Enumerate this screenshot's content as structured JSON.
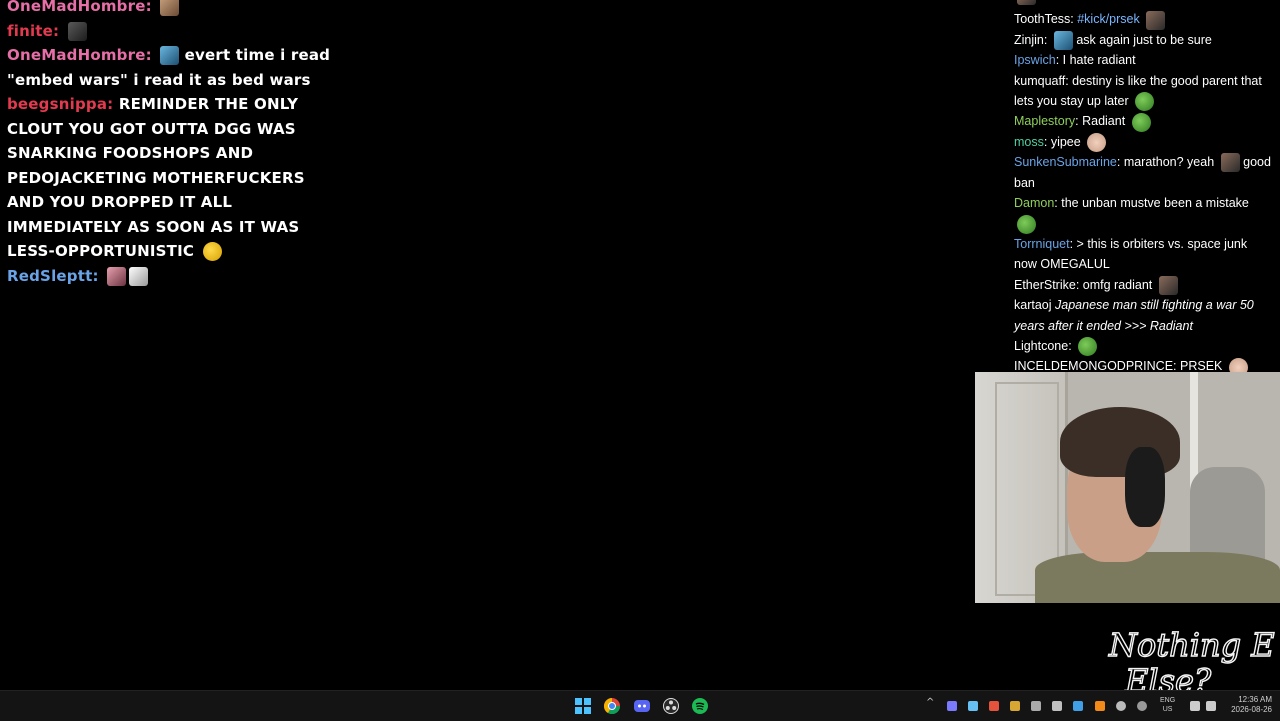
{
  "left_chat": [
    {
      "user": "OneMadHombre",
      "color": "pink",
      "text": "",
      "emotes": [
        "e-face"
      ]
    },
    {
      "user": "finite",
      "color": "red",
      "text": "",
      "emotes": [
        "e-dark"
      ]
    },
    {
      "user": "OneMadHombre",
      "color": "pink",
      "text": "evert time i read \"embed wars\" i read it as bed wars",
      "emotes_before": [
        "e-blue"
      ]
    },
    {
      "user": "beegsnippa",
      "color": "red",
      "text": "REMINDER THE ONLY CLOUT YOU GOT OUTTA DGG WAS SNARKING FOODSHOPS AND PEDOJACKETING MOTHERFUCKERS AND YOU DROPPED IT ALL IMMEDIATELY AS SOON AS IT WAS LESS-OPPORTUNISTIC",
      "emotes": [
        "e-yellow"
      ]
    },
    {
      "user": "RedSleptt",
      "color": "blue",
      "text": "",
      "emotes": [
        "e-pink",
        "e-white"
      ]
    }
  ],
  "right_chat": [
    {
      "user": "",
      "color": "c-white",
      "text": "",
      "emotes": []
    },
    {
      "user": "ToothTess",
      "color": "c-white",
      "text": "#kick/prsek",
      "text_class": "c-lightblue",
      "emotes": [
        "e-man"
      ]
    },
    {
      "user": "Zinjin",
      "color": "c-white",
      "text": "ask again just to be sure",
      "emotes_before": [
        "e-blue"
      ]
    },
    {
      "user": "Ipswich",
      "color": "c-blue",
      "text": "I hate radiant",
      "emotes": []
    },
    {
      "user": "kumquaff",
      "color": "c-white",
      "text": "destiny is like the good parent that lets you stay up later",
      "emotes": [
        "e-frog"
      ]
    },
    {
      "user": "Maplestory",
      "color": "c-lime",
      "text": "Radiant",
      "emotes": [
        "e-frog"
      ]
    },
    {
      "user": "moss",
      "color": "c-teal",
      "text": "yipee",
      "emotes": [
        "e-hand"
      ]
    },
    {
      "user": "SunkenSubmarine",
      "color": "c-blue",
      "text": "marathon? yeah",
      "text2": "good ban",
      "emotes": [
        "e-man"
      ]
    },
    {
      "user": "Damon",
      "color": "c-lime",
      "text": "the unban mustve been a mistake",
      "emotes_after_line": [
        "e-frog"
      ]
    },
    {
      "user": "Torrniquet",
      "color": "c-blue",
      "text": "> this is orbiters vs. space junk now OMEGALUL",
      "emotes": []
    },
    {
      "user": "EtherStrike",
      "color": "c-white",
      "text": "omfg radiant",
      "emotes": [
        "e-man"
      ]
    },
    {
      "user": "kartaoj",
      "color": "c-white",
      "text": "Japanese man still fighting a war 50 years after it ended >>> Radiant",
      "italic": true,
      "emotes": []
    },
    {
      "user": "Lightcone",
      "color": "c-white",
      "text": "",
      "emotes": [
        "e-frog"
      ]
    },
    {
      "user": "INCELDEMONGODPRINCE",
      "color": "c-white",
      "text": "PRSEK",
      "emotes": [
        "e-hand"
      ]
    }
  ],
  "logo": {
    "text": "Nothing Else?"
  },
  "taskbar": {
    "apps": [
      "windows-start",
      "chrome",
      "discord",
      "obs",
      "spotify"
    ],
    "lang": "ENG",
    "region": "US",
    "time": "12:36 AM",
    "date": "2026-08-26"
  }
}
